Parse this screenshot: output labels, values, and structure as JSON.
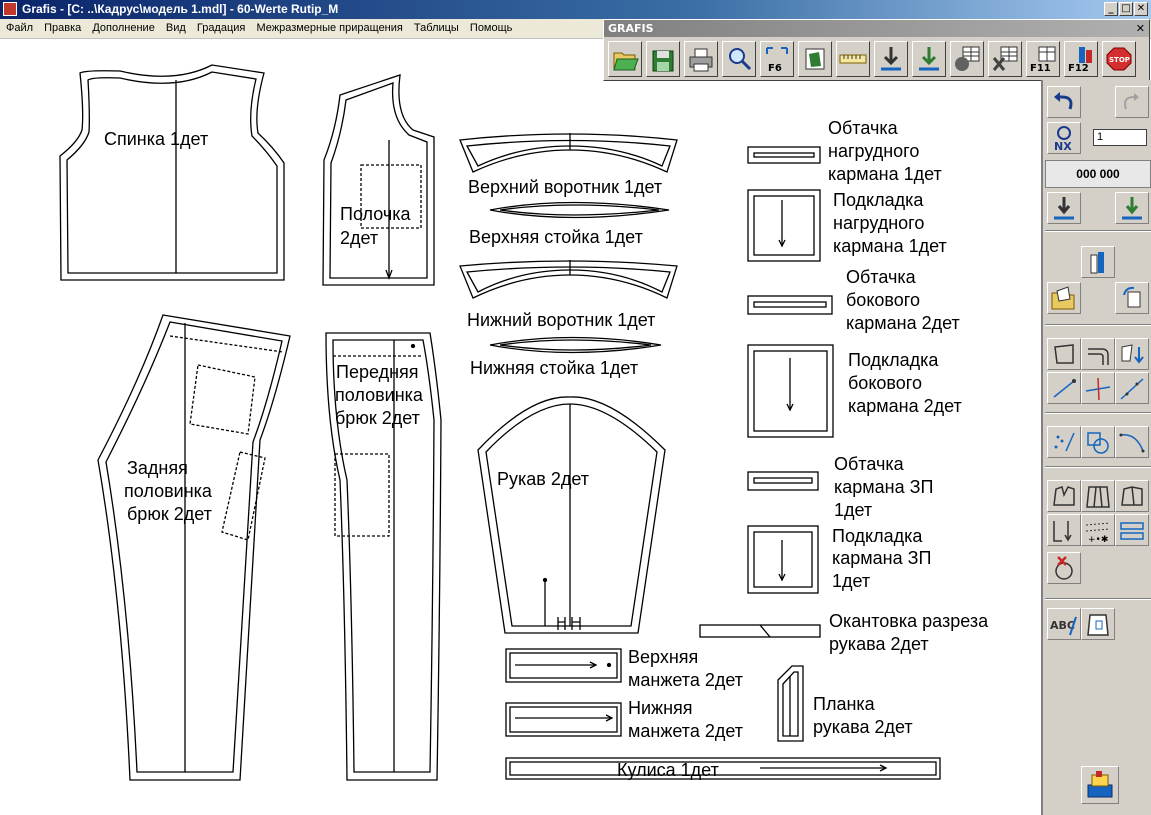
{
  "window": {
    "title": "Grafis - [C: ..\\Кадрус\\модель 1.mdl] - 60-Werte Rutip_M",
    "controls": [
      "_",
      "□",
      "✕"
    ]
  },
  "menu": [
    "Файл",
    "Правка",
    "Дополнение",
    "Вид",
    "Градация",
    "Межразмерные приращения",
    "Таблицы",
    "Помощь"
  ],
  "floating_toolbar": {
    "title": "GRAFIS",
    "close": "✕",
    "buttons": [
      "open-icon",
      "save-icon",
      "print-icon",
      "zoom-icon",
      "fit-f6-icon",
      "frame-icon",
      "measure-tape-icon",
      "import-down-icon",
      "import-green-icon",
      "grading-g-icon",
      "table-x-icon",
      "f11-icon",
      "f12-icon",
      "stop-icon"
    ],
    "labels": {
      "f6": "F6",
      "f11": "F11",
      "f12": "F12",
      "stop": "STOP"
    }
  },
  "right_panel": {
    "nx_value": "1",
    "counter": "000 000",
    "nx_label": "NX"
  },
  "pieces": {
    "back": "Спинка 1дет",
    "front_1": "Полочка",
    "front_2": "2дет",
    "upper_collar": "Верхний воротник 1дет",
    "upper_stand": "Верхняя стойка 1дет",
    "lower_collar": "Нижний воротник 1дет",
    "lower_stand": "Нижняя стойка 1дет",
    "back_pants_1": "Задняя",
    "back_pants_2": "половинка",
    "back_pants_3": "брюк 2дет",
    "front_pants_1": "Передняя",
    "front_pants_2": "половинка",
    "front_pants_3": "брюк 2дет",
    "sleeve": "Рукав 2дет",
    "chest_facing_1": "Обтачка",
    "chest_facing_2": "нагрудного",
    "chest_facing_3": "кармана 1дет",
    "chest_lining_1": "Подкладка",
    "chest_lining_2": "нагрудного",
    "chest_lining_3": "кармана 1дет",
    "side_facing_1": "Обтачка",
    "side_facing_2": "бокового",
    "side_facing_3": "кармана 2дет",
    "side_lining_1": "Подкладка",
    "side_lining_2": "бокового",
    "side_lining_3": "кармана 2дет",
    "back_facing_1": "Обтачка",
    "back_facing_2": "кармана ЗП",
    "back_facing_3": "1дет",
    "back_lining_1": "Подкладка",
    "back_lining_2": "кармана ЗП",
    "back_lining_3": "1дет",
    "binding_1": "Окантовка разреза",
    "binding_2": "рукава 2дет",
    "upper_cuff_1": "Верхняя",
    "upper_cuff_2": "манжета 2дет",
    "lower_cuff_1": "Нижняя",
    "lower_cuff_2": "манжета 2дет",
    "placket_1": "Планка",
    "placket_2": "рукава 2дет",
    "drawstring": "Кулиса 1дет"
  }
}
